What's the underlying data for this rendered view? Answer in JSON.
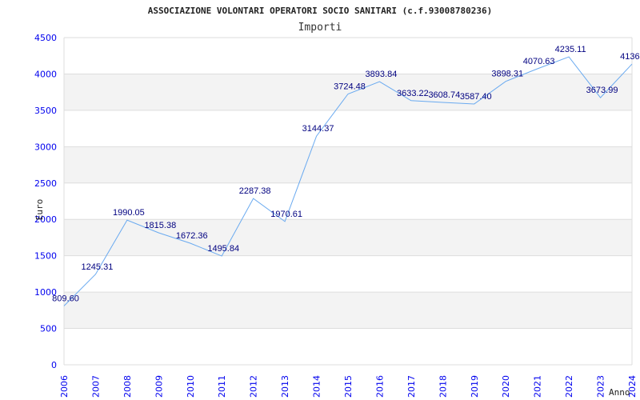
{
  "chart_data": {
    "type": "line",
    "title": "ASSOCIAZIONE VOLONTARI OPERATORI SOCIO SANITARI (c.f.93008780236)",
    "subtitle": "Importi",
    "xlabel": "Anno",
    "ylabel": "Euro",
    "ylim": [
      0,
      4500
    ],
    "yticks": [
      0,
      500,
      1000,
      1500,
      2000,
      2500,
      3000,
      3500,
      4000,
      4500
    ],
    "grid": true,
    "x": [
      "2006",
      "2007",
      "2008",
      "2009",
      "2010",
      "2011",
      "2012",
      "2013",
      "2014",
      "2015",
      "2016",
      "2017",
      "2018",
      "2019",
      "2020",
      "2021",
      "2022",
      "2023",
      "2024"
    ],
    "values": [
      809.6,
      1245.31,
      1990.05,
      1815.38,
      1672.36,
      1495.84,
      2287.38,
      1970.61,
      3144.37,
      3724.48,
      3893.84,
      3633.22,
      3608.74,
      3587.4,
      3898.31,
      4070.63,
      4235.11,
      3673.99,
      4136.0
    ],
    "labels": [
      "809.60",
      "1245.31",
      "1990.05",
      "1815.38",
      "1672.36",
      "1495.84",
      "2287.38",
      "1970.61",
      "3144.37",
      "3724.48",
      "3893.84",
      "3633.22",
      "3608.74",
      "3587.40",
      "3898.31",
      "4070.63",
      "4235.11",
      "3673.99",
      "4136.0"
    ],
    "colors": {
      "line": "#6aaaf0",
      "band": "#f3f3f3",
      "tick": "#0000ee",
      "label": "#000080"
    }
  }
}
